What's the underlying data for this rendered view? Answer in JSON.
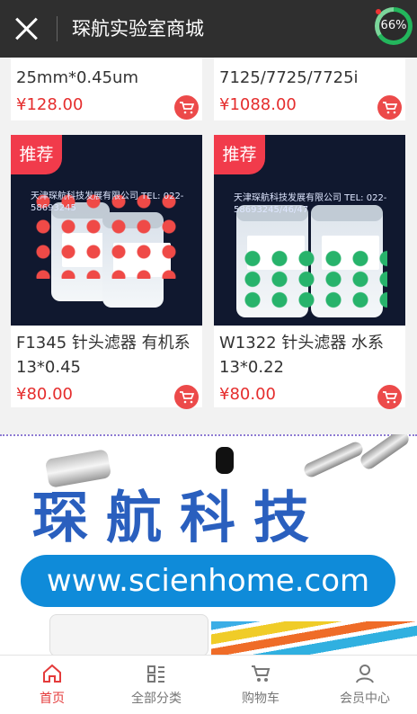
{
  "header": {
    "title": "琛航实验室商城",
    "progress_text": "66%",
    "progress_value": 0.66
  },
  "top_products": [
    {
      "name_line2": "25mm*0.45um",
      "price": "¥128.00"
    },
    {
      "name_line2": "7125/7725/7725i",
      "price": "¥1088.00"
    }
  ],
  "products": [
    {
      "badge": "推荐",
      "name": "F1345 针头滤器 有机系",
      "sub": "13*0.45",
      "price": "¥80.00",
      "watermark": "天津琛航科技发展有限公司 TEL: 022-58693245"
    },
    {
      "badge": "推荐",
      "name": "W1322 针头滤器 水系",
      "sub": "13*0.22",
      "price": "¥80.00",
      "watermark": "天津琛航科技发展有限公司 TEL: 022-58693245/46/47"
    }
  ],
  "banner": {
    "brand": "琛航科技",
    "url": "www.scienhome.com"
  },
  "nav": [
    {
      "label": "首页",
      "icon": "home-icon"
    },
    {
      "label": "全部分类",
      "icon": "category-icon"
    },
    {
      "label": "购物车",
      "icon": "cart-icon"
    },
    {
      "label": "会员中心",
      "icon": "user-icon"
    }
  ],
  "colors": {
    "accent": "#e52d2d",
    "header": "#2f2f2f",
    "badge": "#f13b4b"
  }
}
